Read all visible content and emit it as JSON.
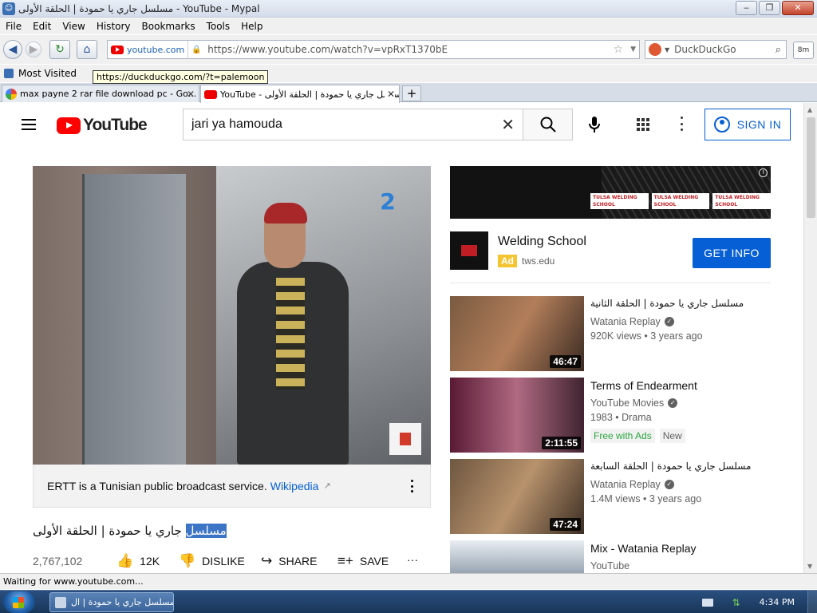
{
  "window": {
    "title": "مسلسل جاري يا حمودة | الحلقة الأولى - YouTube - Mypal",
    "min": "‒",
    "max": "❐",
    "close": "✕"
  },
  "menu": [
    "File",
    "Edit",
    "View",
    "History",
    "Bookmarks",
    "Tools",
    "Help"
  ],
  "nav": {
    "site": "youtube.com",
    "url": "https://www.youtube.com/watch?v=vpRxT1370bE",
    "search_engine": "DuckDuckGo",
    "extension_label": "8m"
  },
  "bookmarks": {
    "item": "Most Visited",
    "tooltip": "https://duckduckgo.com/?t=palemoon"
  },
  "tabs": [
    {
      "title": "max payne 2 rar file download pc - Go...",
      "close": "✕"
    },
    {
      "title": "مسلسل جاري يا حمودة | الحلقة الأولى - YouTube",
      "close": "✕"
    }
  ],
  "newtab": "+",
  "yt": {
    "logo": "YouTube",
    "search_value": "jari ya hamouda",
    "search_clear": "✕",
    "signin": "SIGN IN",
    "video": {
      "channel_logo": "2",
      "info_text": "ERTT is a Tunisian public broadcast service.",
      "info_link": "Wikipedia",
      "title_highlight": "مسلسل",
      "title_rest": "جاري يا حمودة | الحلقة الأولى",
      "views": "2,767,102",
      "likes": "12K",
      "dislike": "DISLIKE",
      "share": "SHARE",
      "save": "SAVE",
      "more": "···"
    },
    "ad": {
      "banner_tags": [
        "TULSA WELDING SCHOOL",
        "TULSA WELDING SCHOOL",
        "TULSA WELDING SCHOOL"
      ],
      "title": "Welding School",
      "badge": "Ad",
      "domain": "tws.edu",
      "cta": "GET INFO",
      "info_icon": "i"
    },
    "recs": [
      {
        "title": "مسلسل جاري يا حمودة | الحلقة الثانية",
        "channel": "Watania Replay",
        "meta": "920K views • 3 years ago",
        "duration": "46:47"
      },
      {
        "title": "Terms of Endearment",
        "channel": "YouTube Movies",
        "meta": "1983 • Drama",
        "duration": "2:11:55",
        "badge_free": "Free with Ads",
        "badge_new": "New"
      },
      {
        "title": "مسلسل جاري يا حمودة | الحلقة السابعة",
        "channel": "Watania Replay",
        "meta": "1.4M views • 3 years ago",
        "duration": "47:24"
      },
      {
        "title": "Mix - Watania Replay",
        "channel": "YouTube",
        "meta": ""
      }
    ]
  },
  "status": "Waiting for www.youtube.com...",
  "taskbar": {
    "item": "مسلسل جاري يا حمودة | ال...",
    "time": "4:34 PM"
  }
}
